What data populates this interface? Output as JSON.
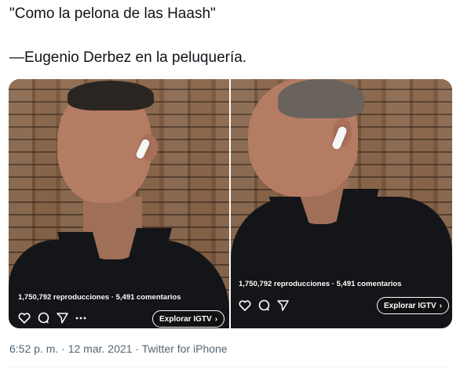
{
  "tweet": {
    "line1": "\"Como la pelona de las Haash\"",
    "line2": "—Eugenio Derbez en la peluquería."
  },
  "media": {
    "left": {
      "stats": "1,750,792 reproducciones · 5,491 comentarios",
      "explore_label": "Explorar IGTV",
      "explore_chevron": "›"
    },
    "right": {
      "stats": "1,750,792 reproducciones · 5,491 comentarios",
      "explore_label": "Explorar IGTV",
      "explore_chevron": "›"
    },
    "icons": [
      "heart-icon",
      "comment-icon",
      "share-icon",
      "more-icon"
    ]
  },
  "meta": {
    "time": "6:52 p. m.",
    "sep1": " · ",
    "date": "12 mar. 2021",
    "sep2": " · ",
    "client": "Twitter for iPhone"
  },
  "colors": {
    "text": "#0f1419",
    "secondary": "#536471",
    "background": "#ffffff"
  }
}
